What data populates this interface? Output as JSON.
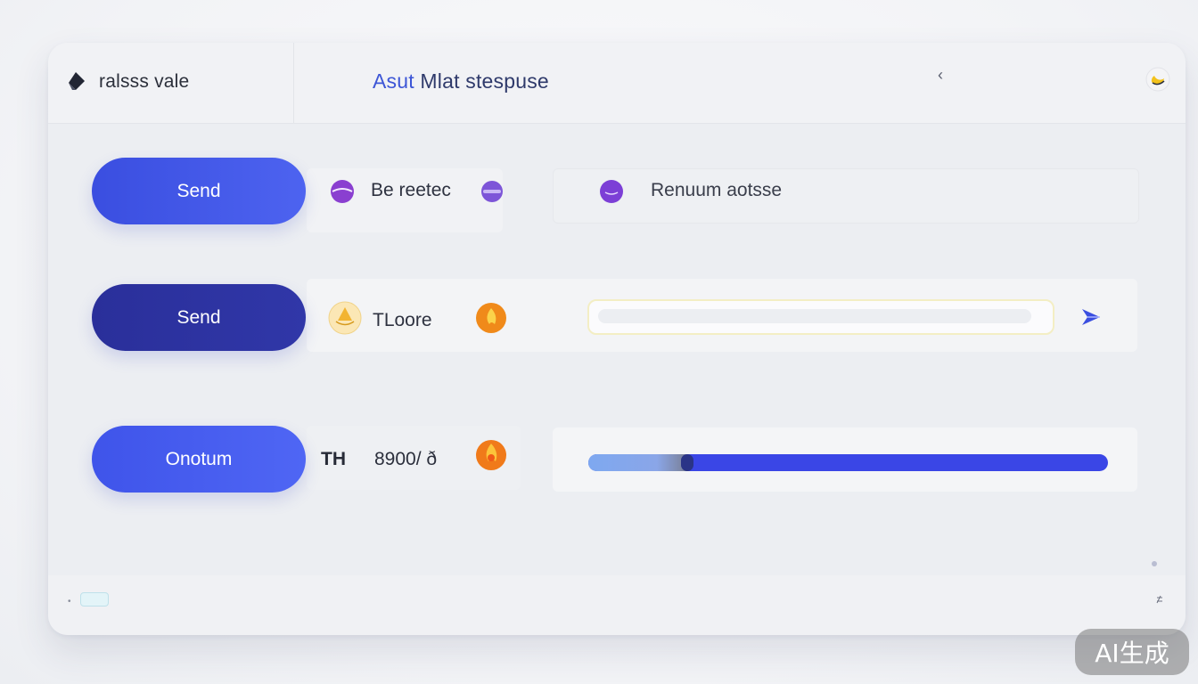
{
  "header": {
    "app_name": "ralsss vale",
    "title_accent": "Asut",
    "title_rest": " Mlat stespuse",
    "back_glyph": "‹"
  },
  "rows": [
    {
      "button_label": "Send",
      "item_label": "Be reetec",
      "right_label": "Renuum aotsse"
    },
    {
      "button_label": "Send",
      "item_label": "TLoore",
      "input_value": "",
      "send_icon": "send-arrow-icon"
    },
    {
      "button_label": "Onotum",
      "item_label_a": "TH",
      "item_label_b": "8900/ ð",
      "progress": 0.81
    }
  ],
  "watermark": "AI生成",
  "colors": {
    "accent": "#3d56d6",
    "button_blue": "#4058e8",
    "button_dark": "#2c329e",
    "purple": "#8a3fd0",
    "amber": "#f2b431",
    "orange": "#f07a1a"
  },
  "icons": [
    "app-logo-icon",
    "back-chevron-icon",
    "theme-toggle-icon",
    "purple-orb-icon",
    "amber-orb-icon",
    "flame-orb-icon",
    "send-arrow-icon"
  ]
}
